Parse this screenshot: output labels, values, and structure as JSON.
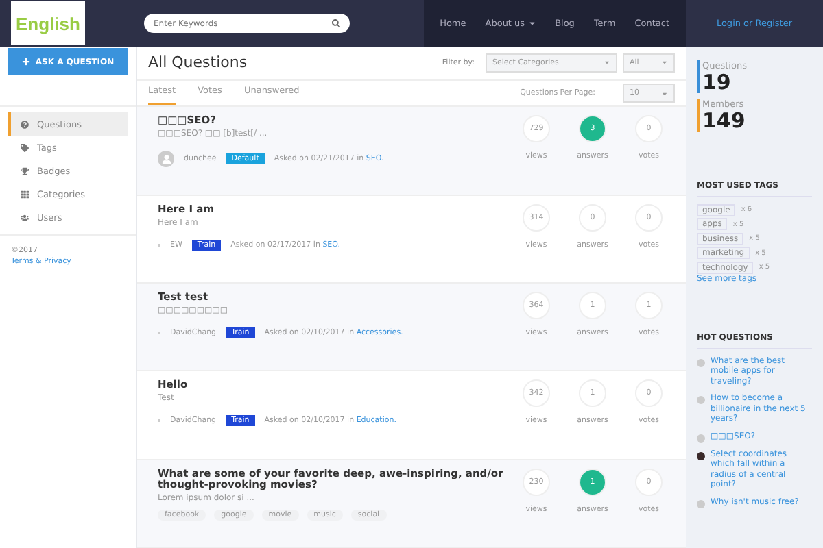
{
  "header": {
    "logo_text": "English",
    "search": {
      "placeholder": "Enter Keywords"
    },
    "nav": [
      {
        "label": "Home",
        "dropdown": false
      },
      {
        "label": "About us",
        "dropdown": true
      },
      {
        "label": "Blog",
        "dropdown": false
      },
      {
        "label": "Term",
        "dropdown": false
      },
      {
        "label": "Contact",
        "dropdown": false
      }
    ],
    "login": "Login or Register"
  },
  "sidebar": {
    "ask_button": "ASK A QUESTION",
    "items": [
      {
        "label": "Questions",
        "selected": true
      },
      {
        "label": "Tags",
        "selected": false
      },
      {
        "label": "Badges",
        "selected": false
      },
      {
        "label": "Categories",
        "selected": false
      },
      {
        "label": "Users",
        "selected": false
      }
    ],
    "copyright": "©2017",
    "terms": "Terms & Privacy"
  },
  "main": {
    "title": "All Questions",
    "filter_label": "Filter by:",
    "category_select": "Select Categories",
    "status_select": "All",
    "tabs": [
      {
        "label": "Latest",
        "selected": true
      },
      {
        "label": "Votes",
        "selected": false
      },
      {
        "label": "Unanswered",
        "selected": false
      }
    ],
    "per_page_label": "Questions Per Page:",
    "per_page": "10",
    "questions": [
      {
        "title": "□□□SEO?",
        "excerpt": "□□□SEO? □□ [b]test[/ ...",
        "kind": "meta",
        "avatar": true,
        "user": "dunchee",
        "badge": {
          "text": "Default",
          "color": "#1aa3dd"
        },
        "asked": "Asked on 02/21/2017 in",
        "category": "SEO.",
        "stats": [
          {
            "value": "729",
            "label": "views",
            "highlighted": false
          },
          {
            "value": "3",
            "label": "answers",
            "highlighted": true
          },
          {
            "value": "0",
            "label": "votes",
            "highlighted": false
          }
        ]
      },
      {
        "title": "Here I am",
        "excerpt": "Here I am",
        "kind": "meta",
        "avatar": false,
        "user": "EW",
        "badge": {
          "text": "Train",
          "color": "#1f47d6"
        },
        "asked": "Asked on 02/17/2017 in",
        "category": "SEO.",
        "stats": [
          {
            "value": "314",
            "label": "views",
            "highlighted": false
          },
          {
            "value": "0",
            "label": "answers",
            "highlighted": false
          },
          {
            "value": "0",
            "label": "votes",
            "highlighted": false
          }
        ]
      },
      {
        "title": "Test test",
        "excerpt": "□□□□□□□□□",
        "kind": "meta",
        "avatar": false,
        "user": "DavidChang",
        "badge": {
          "text": "Train",
          "color": "#1f47d6"
        },
        "asked": "Asked on 02/10/2017 in",
        "category": "Accessories.",
        "stats": [
          {
            "value": "364",
            "label": "views",
            "highlighted": false
          },
          {
            "value": "1",
            "label": "answers",
            "highlighted": false
          },
          {
            "value": "1",
            "label": "votes",
            "highlighted": false
          }
        ]
      },
      {
        "title": "Hello",
        "excerpt": "Test",
        "kind": "meta",
        "avatar": false,
        "user": "DavidChang",
        "badge": {
          "text": "Train",
          "color": "#1f47d6"
        },
        "asked": "Asked on 02/10/2017 in",
        "category": "Education.",
        "stats": [
          {
            "value": "342",
            "label": "views",
            "highlighted": false
          },
          {
            "value": "1",
            "label": "answers",
            "highlighted": false
          },
          {
            "value": "0",
            "label": "votes",
            "highlighted": false
          }
        ]
      },
      {
        "title": "What are some of your favorite deep, awe-inspiring, and/or thought-provoking movies?",
        "excerpt": "Lorem ipsum dolor si ...",
        "kind": "tags",
        "tags": [
          "facebook",
          "google",
          "movie",
          "music",
          "social"
        ],
        "stats": [
          {
            "value": "230",
            "label": "views",
            "highlighted": false
          },
          {
            "value": "1",
            "label": "answers",
            "highlighted": true
          },
          {
            "value": "0",
            "label": "votes",
            "highlighted": false
          }
        ]
      }
    ]
  },
  "right": {
    "stats": [
      {
        "label": "Questions",
        "value": "19",
        "color": "#3a8fd8"
      },
      {
        "label": "Members",
        "value": "149",
        "color": "#f0a030"
      }
    ],
    "tags_title": "MOST USED TAGS",
    "tags": [
      {
        "name": "google",
        "count": "x 6"
      },
      {
        "name": "apps",
        "count": "x 5"
      },
      {
        "name": "business",
        "count": "x 5"
      },
      {
        "name": "marketing",
        "count": "x 5"
      },
      {
        "name": "technology",
        "count": "x 5"
      }
    ],
    "more_tags": "See more tags",
    "hot_title": "HOT QUESTIONS",
    "hot": [
      {
        "title": "What are the best mobile apps for traveling?",
        "photo_avatar": false
      },
      {
        "title": "How to become a billionaire in the next 5 years?",
        "photo_avatar": false
      },
      {
        "title": "□□□SEO?",
        "photo_avatar": false
      },
      {
        "title": "Select coordinates which fall within a radius of a central point?",
        "photo_avatar": true
      },
      {
        "title": "Why isn't music free?",
        "photo_avatar": false
      }
    ]
  }
}
